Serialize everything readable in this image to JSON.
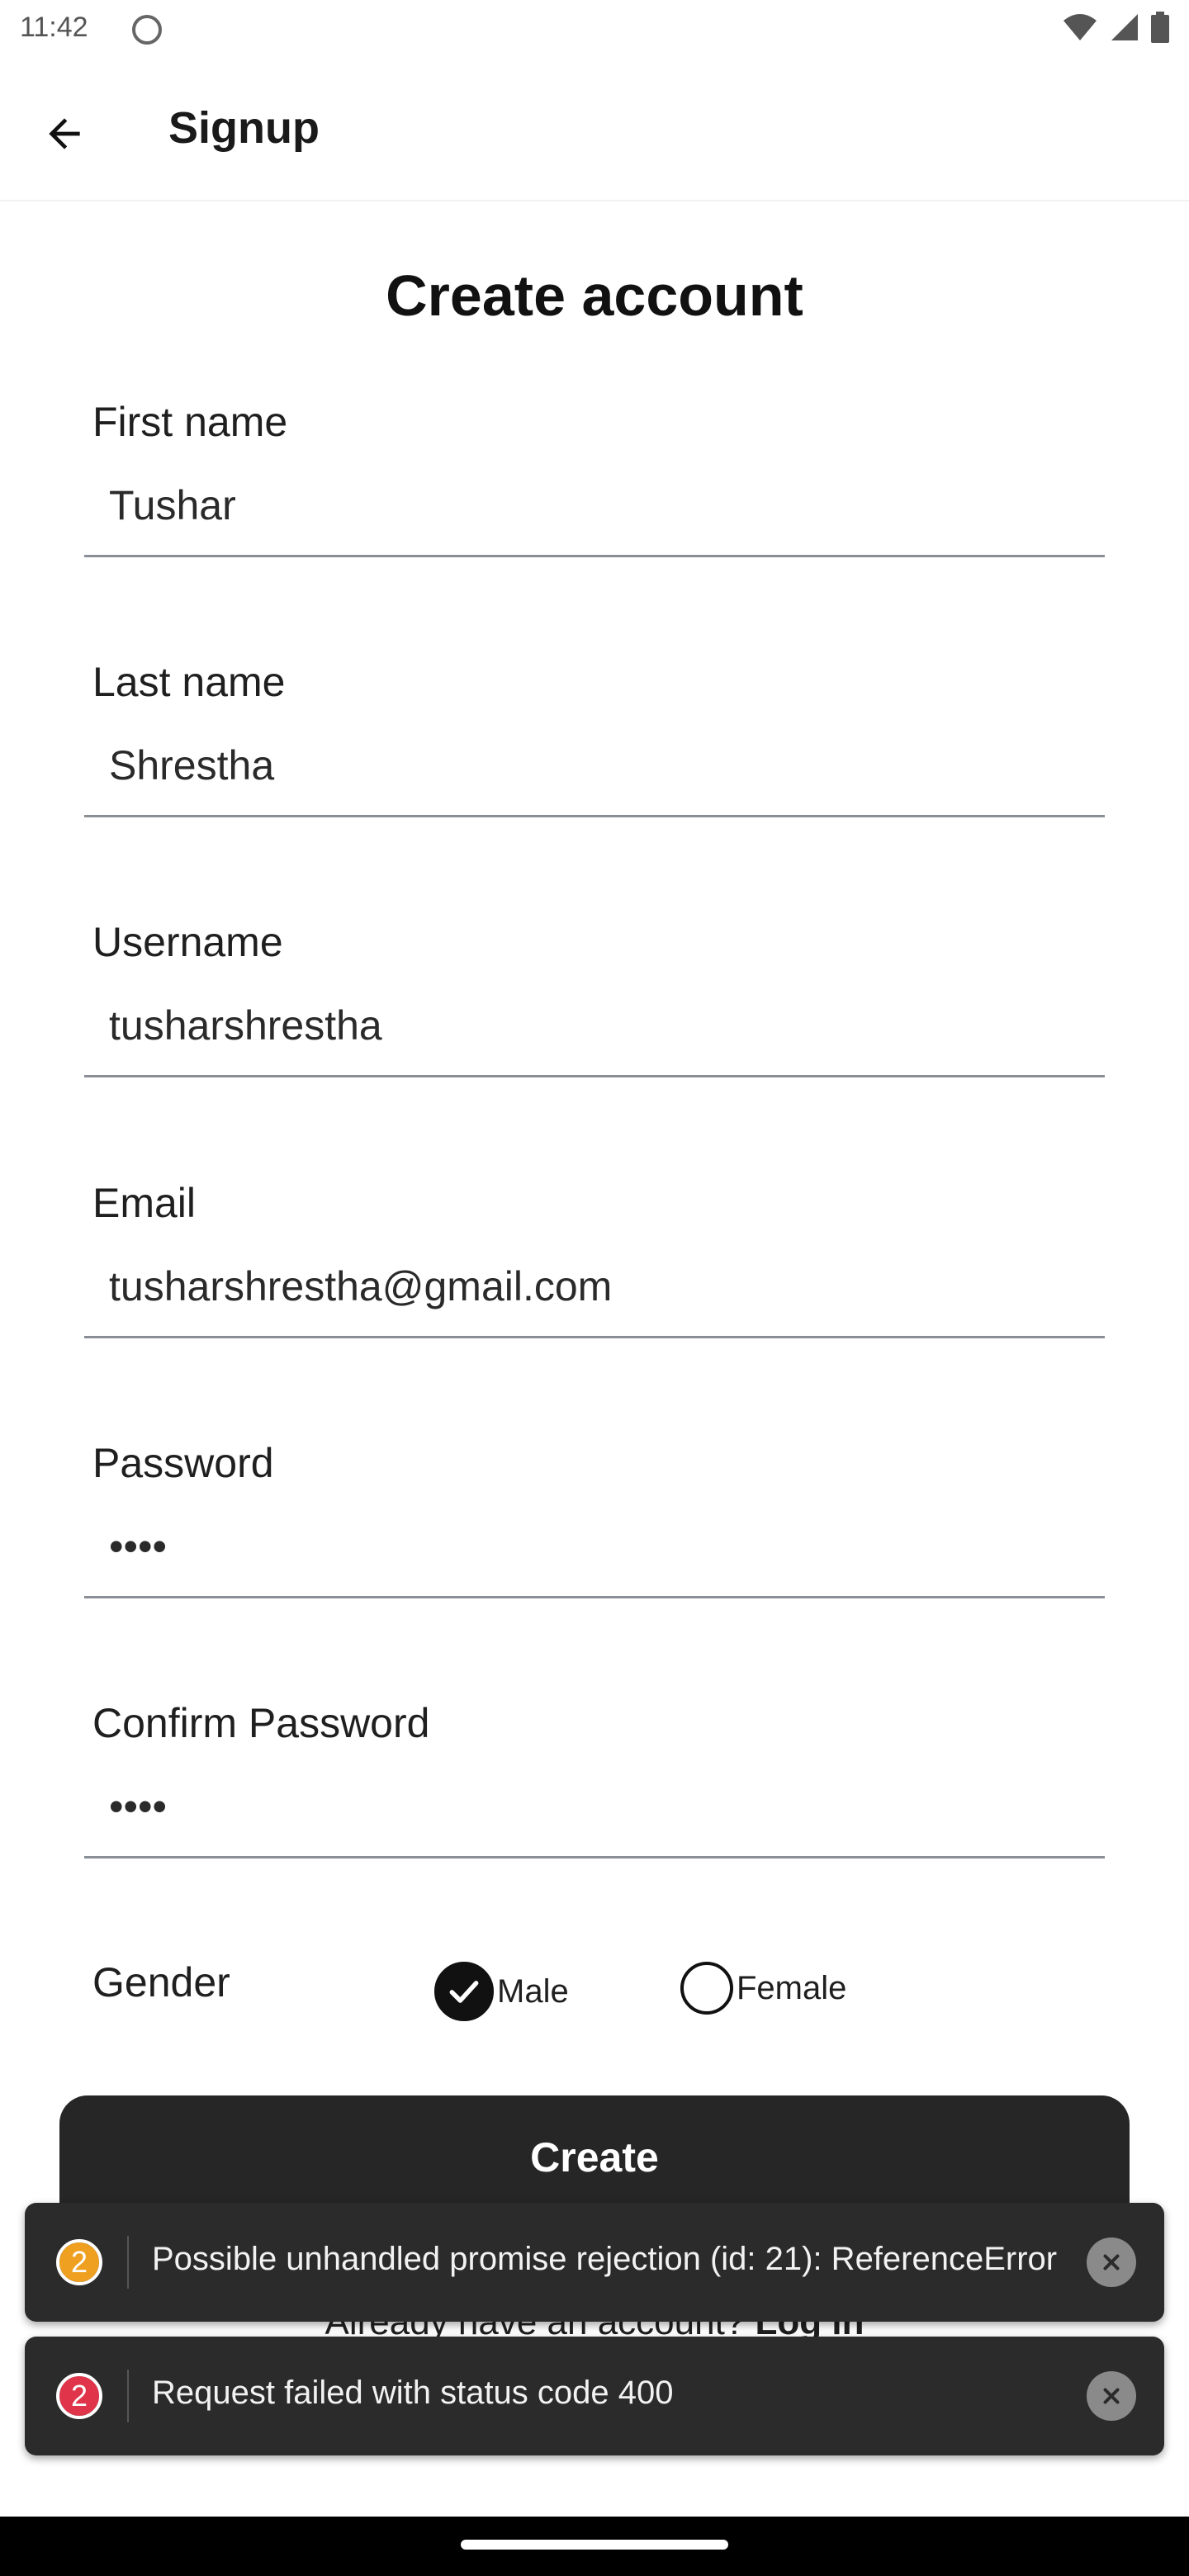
{
  "status_bar": {
    "time": "11:42",
    "icons": [
      "app-notification-icon",
      "wifi-icon",
      "signal-icon",
      "battery-icon"
    ]
  },
  "app_bar": {
    "title": "Signup",
    "back_icon": "arrow-left-icon"
  },
  "form": {
    "title": "Create account",
    "fields": [
      {
        "label": "First name",
        "value": "Tushar"
      },
      {
        "label": "Last name",
        "value": "Shrestha"
      },
      {
        "label": "Username",
        "value": "tusharshrestha"
      },
      {
        "label": "Email",
        "value": "tusharshrestha@gmail.com"
      },
      {
        "label": "Password",
        "value": "••••"
      },
      {
        "label": "Confirm Password",
        "value": "••••"
      }
    ],
    "gender": {
      "label": "Gender",
      "options": [
        {
          "label": "Male",
          "selected": true
        },
        {
          "label": "Female",
          "selected": false
        }
      ]
    },
    "create_label": "Create",
    "login_prompt": "Already have an account?",
    "login_link": "Log in"
  },
  "toasts": [
    {
      "count": "2",
      "color": "#f0a020",
      "message": "Possible unhandled promise rejection (id: 21): ReferenceError"
    },
    {
      "count": "2",
      "color": "#e0344a",
      "message": "Request failed with status code 400"
    }
  ],
  "colors": {
    "primary_button": "#262626",
    "field_underline": "#8a8f96",
    "toast_bg": "#2b2b2b"
  }
}
